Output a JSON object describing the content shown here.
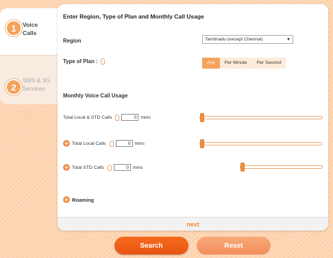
{
  "steps": [
    {
      "number": "1",
      "label": "Voice Calls",
      "active": true
    },
    {
      "number": "2",
      "label": "SMS & 3G Services",
      "active": false
    }
  ],
  "form": {
    "title": "Enter Region, Type of Plan and Monthly Call Usage",
    "region_label": "Region",
    "region_value": "Tamilnadu (except Chennai)",
    "plan_label": "Type of Plan :",
    "plan_options": [
      "Any",
      "Per Minute",
      "Per Second"
    ],
    "plan_selected": "Any",
    "usage_heading": "Monthly Voice Call Usage",
    "rows": [
      {
        "label": "Total Local & STD Calls",
        "value": "0",
        "unit": "mins",
        "slider_level": 0.0
      },
      {
        "label": "Total Local Calls",
        "value": "0",
        "unit": "mins",
        "slider_level": 0.0
      },
      {
        "label": "Total STD Calls",
        "value": "0",
        "unit": "mins",
        "slider_level": 0.0
      }
    ],
    "roaming_label": "Roaming",
    "next_label": "next"
  },
  "buttons": {
    "search_label": "Search",
    "reset_label": "Reset"
  },
  "colors": {
    "accent": "#f5a35a",
    "search_button": "#f05f16",
    "reset_button": "#f49a68",
    "next_link": "#f08a3a"
  },
  "icons": [
    "info-icon",
    "plus-icon",
    "dropdown-arrow-icon"
  ]
}
